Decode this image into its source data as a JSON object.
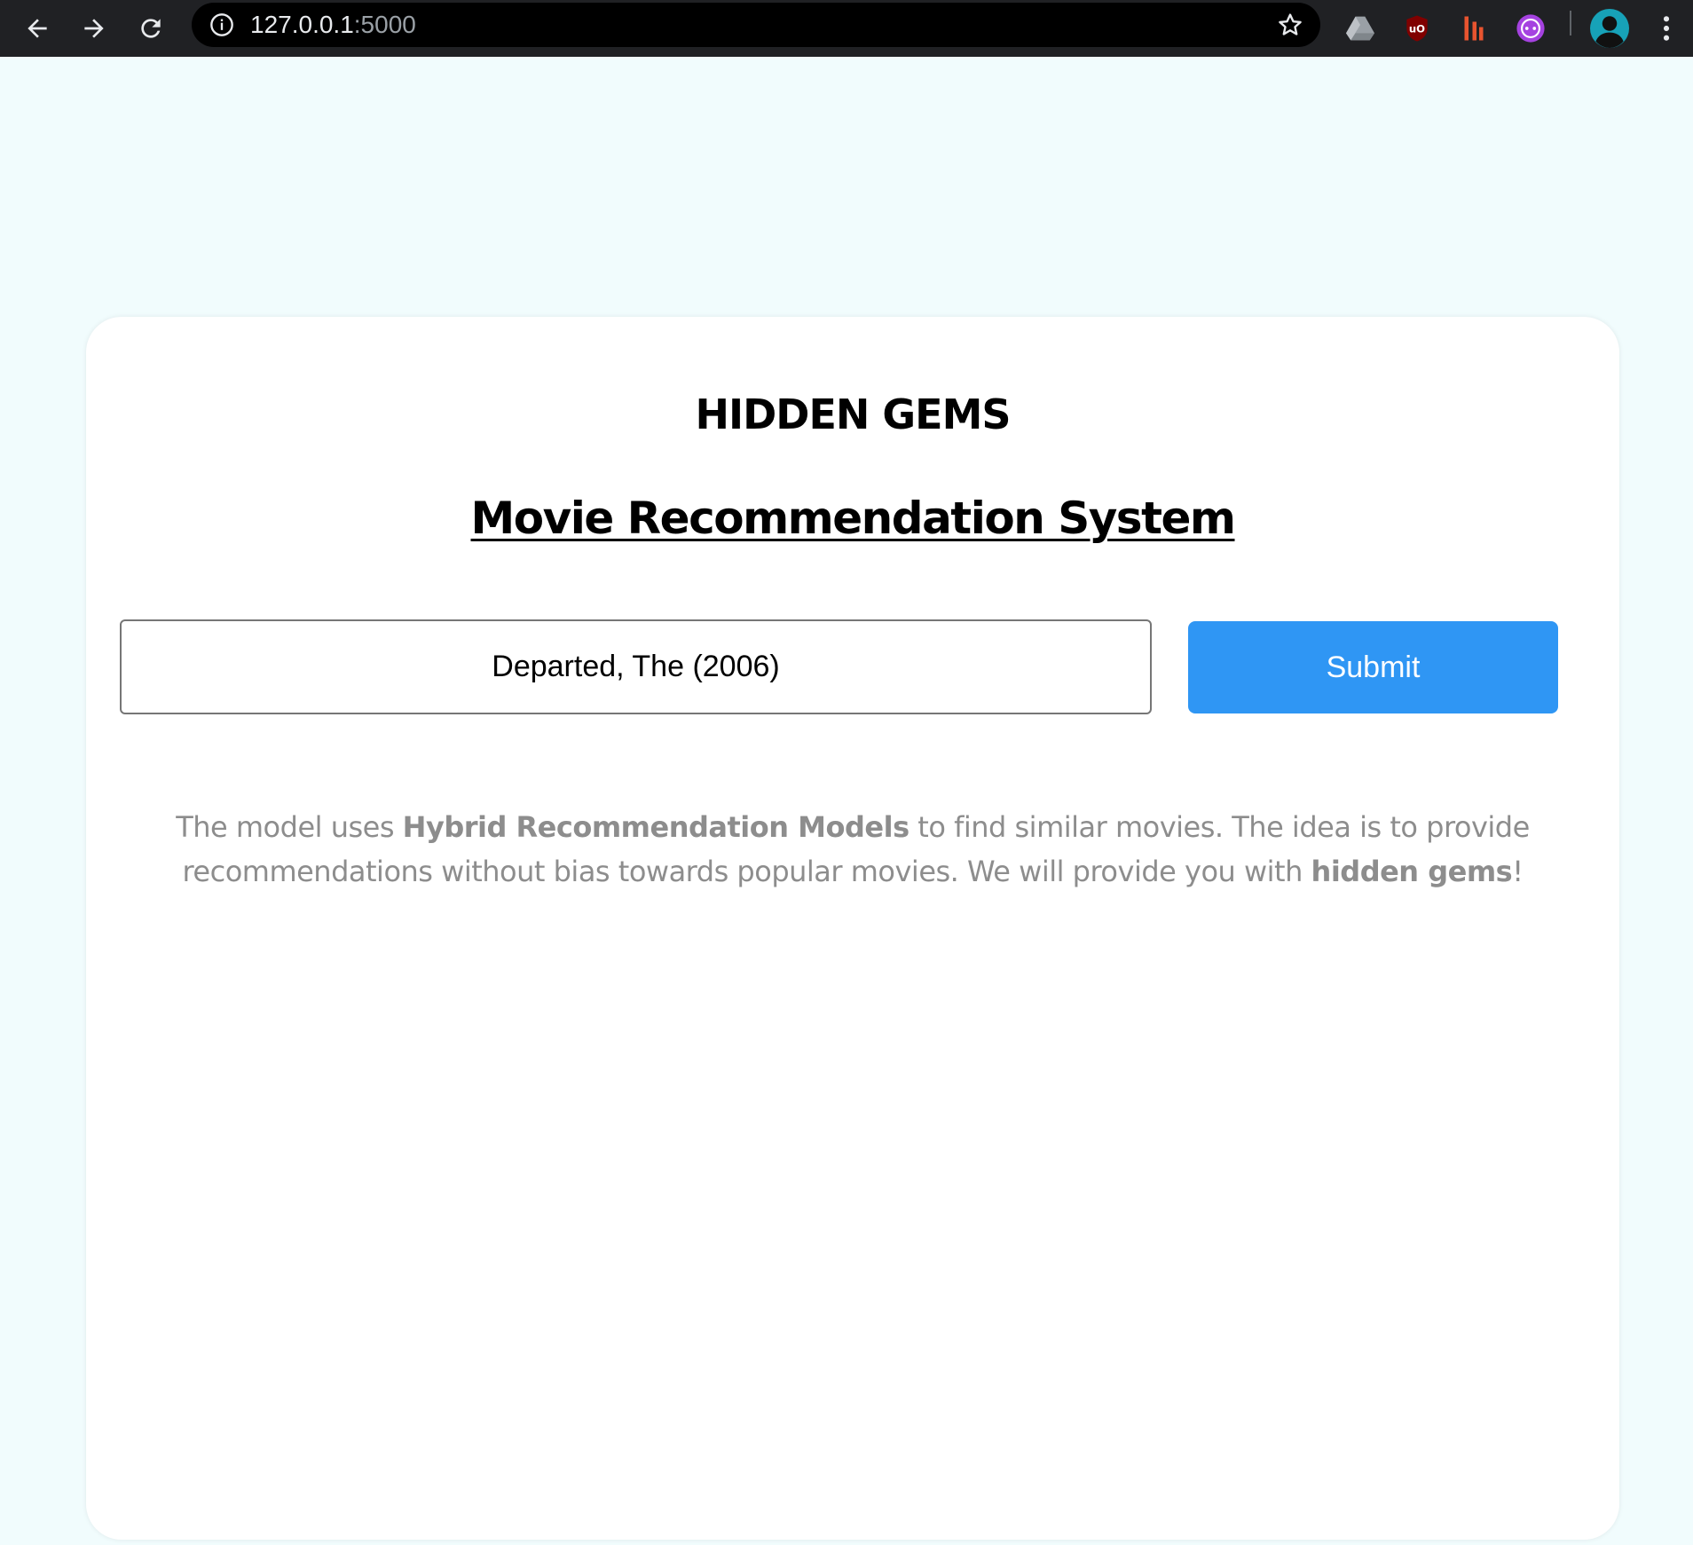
{
  "browser": {
    "url_host": "127.0.0.1",
    "url_port": ":5000",
    "extensions": [
      "google-drive-icon",
      "ublock-origin-icon",
      "extension-bars-icon",
      "extension-purple-icon",
      "profile-avatar"
    ]
  },
  "page": {
    "title": "HIDDEN GEMS",
    "subtitle": "Movie Recommendation System",
    "input_value": "Departed, The (2006)",
    "submit_label": "Submit",
    "description": {
      "part1": "The model uses ",
      "bold1": "Hybrid Recommendation Models",
      "part2": " to find similar movies. The idea is to provide recommendations without bias towards popular movies. We will provide you with ",
      "bold2": "hidden gems",
      "part3": "!"
    }
  },
  "colors": {
    "background": "#f1fcfd",
    "card": "#ffffff",
    "submit_button": "#2f96f4",
    "description_text": "#8d8d8d",
    "browser_bar": "#202124"
  }
}
